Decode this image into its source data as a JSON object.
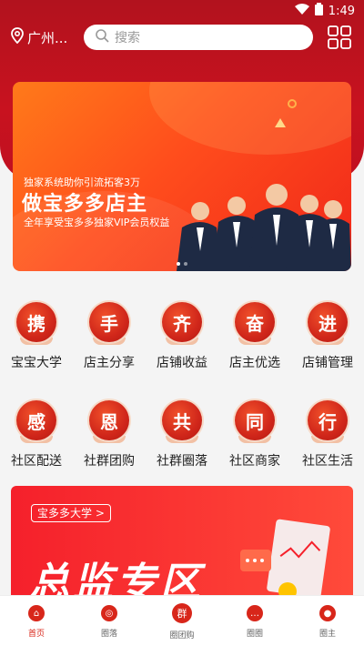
{
  "status_bar": {
    "time": "1:49"
  },
  "header": {
    "location": "广州...",
    "search_placeholder": "搜索"
  },
  "banner": {
    "subtitle_top": "独家系统助你引流拓客3万",
    "title": "做宝多多店主",
    "subtitle_bottom": "全年享受宝多多独家VIP会员权益"
  },
  "grid_row1": [
    {
      "char": "携",
      "label": "宝宝大学"
    },
    {
      "char": "手",
      "label": "店主分享"
    },
    {
      "char": "齐",
      "label": "店铺收益"
    },
    {
      "char": "奋",
      "label": "店主优选"
    },
    {
      "char": "进",
      "label": "店铺管理"
    }
  ],
  "grid_row2": [
    {
      "char": "感",
      "label": "社区配送"
    },
    {
      "char": "恩",
      "label": "社群团购"
    },
    {
      "char": "共",
      "label": "社群圈落"
    },
    {
      "char": "同",
      "label": "社区商家"
    },
    {
      "char": "行",
      "label": "社区生活"
    }
  ],
  "promo": {
    "tag": "宝多多大学 >",
    "title": "总监专区"
  },
  "bottom_nav": [
    {
      "icon": "home-icon",
      "glyph": "⌂",
      "label": "首页"
    },
    {
      "icon": "circle-icon",
      "glyph": "◎",
      "label": "圈落"
    },
    {
      "icon": "group-buy-icon",
      "glyph": "群",
      "label": "圈团购"
    },
    {
      "icon": "chat-icon",
      "glyph": "…",
      "label": "圈圈"
    },
    {
      "icon": "profile-icon",
      "glyph": "●",
      "label": "圈主"
    }
  ],
  "colors": {
    "brand_red": "#c8121f",
    "accent_orange": "#ff6a1a"
  }
}
